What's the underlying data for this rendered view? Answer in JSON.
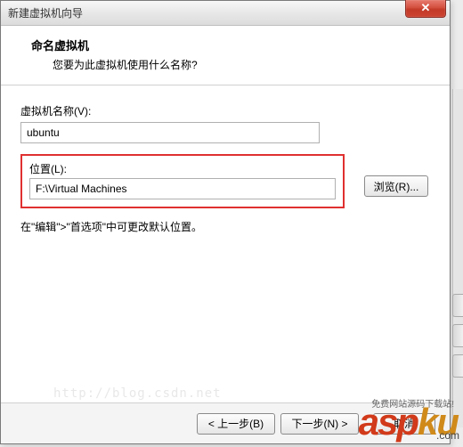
{
  "window": {
    "title": "新建虚拟机向导",
    "close_symbol": "✕"
  },
  "header": {
    "title": "命名虚拟机",
    "subtitle": "您要为此虚拟机使用什么名称?"
  },
  "fields": {
    "name_label": "虚拟机名称(V):",
    "name_value": "ubuntu",
    "location_label": "位置(L):",
    "location_value": "F:\\Virtual Machines",
    "browse_label": "浏览(R)..."
  },
  "hint": "在\"编辑\">\"首选项\"中可更改默认位置。",
  "buttons": {
    "back": "< 上一步(B)",
    "next": "下一步(N) >",
    "cancel": "取消"
  },
  "watermark": {
    "part1": "asp",
    "part2": "ku",
    "domain": ".com",
    "tagline": "免费网站源码下载站!"
  },
  "faint_url": "http://blog.csdn.net"
}
